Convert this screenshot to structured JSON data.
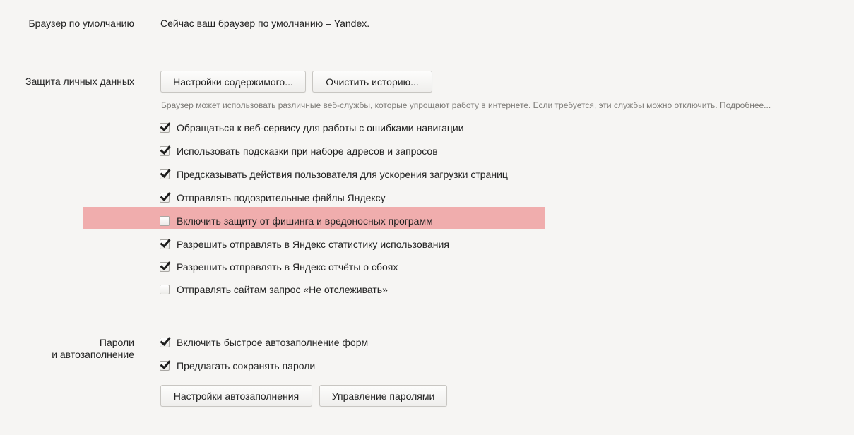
{
  "default_browser": {
    "label": "Браузер по умолчанию",
    "text": "Сейчас ваш браузер по умолчанию – Yandex."
  },
  "privacy": {
    "label": "Защита личных данных",
    "content_settings_button": "Настройки содержимого...",
    "clear_history_button": "Очистить историю...",
    "description": "Браузер может использовать различные веб-службы, которые упрощают работу в интернете. Если требуется, эти службы можно отключить.",
    "more_link": "Подробнее...",
    "options": [
      {
        "label": "Обращаться к веб-сервису для работы с ошибками навигации",
        "checked": true
      },
      {
        "label": "Использовать подсказки при наборе адресов и запросов",
        "checked": true
      },
      {
        "label": "Предсказывать действия пользователя для ускорения загрузки страниц",
        "checked": true
      },
      {
        "label": "Отправлять подозрительные файлы Яндексу",
        "checked": true
      },
      {
        "label": "Включить защиту от фишинга и вредоносных программ",
        "checked": false,
        "highlighted": true
      },
      {
        "label": "Разрешить отправлять в Яндекс статистику использования",
        "checked": true
      },
      {
        "label": "Разрешить отправлять в Яндекс отчёты о сбоях",
        "checked": true
      },
      {
        "label": "Отправлять сайтам запрос «Не отслеживать»",
        "checked": false
      }
    ]
  },
  "passwords": {
    "label_line1": "Пароли",
    "label_line2": "и автозаполнение",
    "options": [
      {
        "label": "Включить быстрое автозаполнение форм",
        "checked": true
      },
      {
        "label": "Предлагать сохранять пароли",
        "checked": true
      }
    ],
    "autofill_settings_button": "Настройки автозаполнения",
    "manage_passwords_button": "Управление паролями"
  },
  "colors": {
    "background": "#f6f5f3",
    "highlight": "#f0adad",
    "description_text": "#7d7b77"
  }
}
